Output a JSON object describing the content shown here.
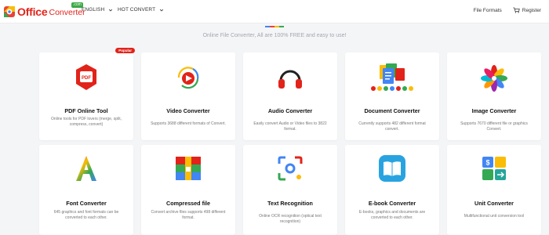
{
  "header": {
    "logo_office": "Office",
    "logo_converter": "Converter",
    "logo_badge": ".com",
    "nav_english": "ENGLISH",
    "nav_hot": "HOT CONVERT",
    "file_formats": "File Formats",
    "register": "Register"
  },
  "tagline": "Online File Converter, All are 100% FREE and easy to use!",
  "badge_popular": "Popular",
  "colors": {
    "brand_red": "#e2231a",
    "line": [
      "#4285f4",
      "#ea4335",
      "#fbbc05",
      "#34a853"
    ]
  },
  "tools": [
    {
      "icon": "pdf-icon",
      "title": "PDF Online Tool",
      "desc": "Online tools for PDF lovers (merge, split, compress, convert)"
    },
    {
      "icon": "video-icon",
      "title": "Video Converter",
      "desc": "Supports 3688 different formats of Convert."
    },
    {
      "icon": "headphones-icon",
      "title": "Audio Converter",
      "desc": "Easily convert Audio or Video files to 3822 format."
    },
    {
      "icon": "documents-icon",
      "title": "Document Converter",
      "desc": "Currently supports 482 different format convert."
    },
    {
      "icon": "pinwheel-icon",
      "title": "Image Converter",
      "desc": "Supports 7670 different file or graphics Convert."
    },
    {
      "icon": "letter-a-icon",
      "title": "Font Converter",
      "desc": "645 graphics and font formats can be converted to each other."
    },
    {
      "icon": "archive-icon",
      "title": "Compressed file",
      "desc": "Convert archive files supports 498 different format."
    },
    {
      "icon": "lens-icon",
      "title": "Text Recognition",
      "desc": "Online OCR recognition (optical text recognition)"
    },
    {
      "icon": "book-icon",
      "title": "E-book Converter",
      "desc": "E-books, graphics and documents are converted to each other."
    },
    {
      "icon": "unit-icon",
      "title": "Unit Converter",
      "desc": "Multifunctional unit conversion tool"
    }
  ]
}
